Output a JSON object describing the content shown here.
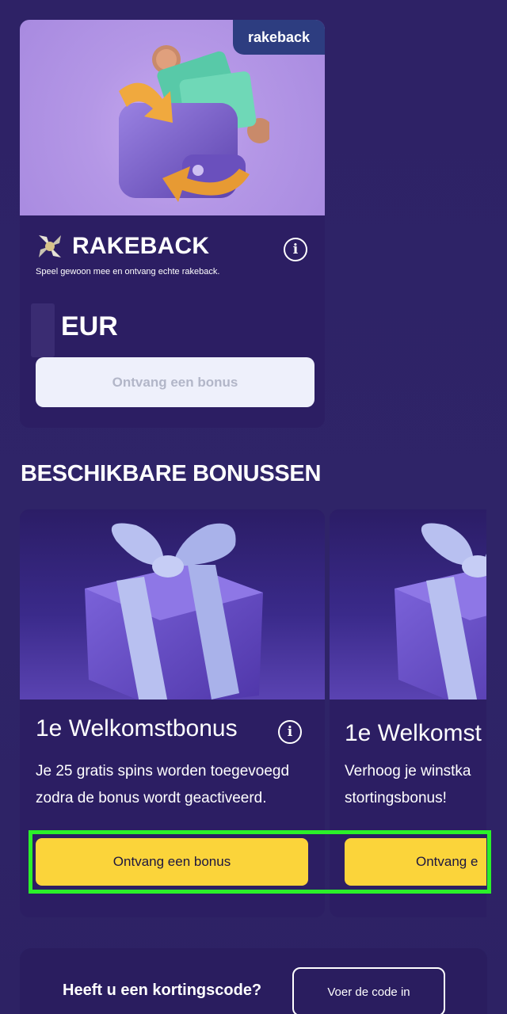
{
  "rakeback": {
    "tag": "rakeback",
    "title": "RAKEBACK",
    "description": "Speel gewoon mee en ontvang echte rakeback.",
    "currency": "EUR",
    "button_label": "Ontvang een bonus"
  },
  "available_section": {
    "title": "BESCHIKBARE BONUSSEN"
  },
  "bonuses": [
    {
      "title": "1e Welkomstbonus",
      "description": "Je 25 gratis spins worden toegevoegd zodra de bonus wordt geactiveerd.",
      "button_label": "Ontvang een bonus"
    },
    {
      "title": "1e Welkomst",
      "description": "Verhoog je winstka stortingsbonus!",
      "button_label": "Ontvang e"
    }
  ],
  "promo": {
    "label": "Heeft u een kortingscode?",
    "button_label": "Voer de code in"
  },
  "colors": {
    "background": "#2f2468",
    "card": "#2c1e63",
    "accent_yellow": "#fbd43a",
    "highlight_green": "#2bf02a"
  },
  "icons": [
    "info-icon",
    "rakeback-logo-icon",
    "wallet-illustration",
    "gift-illustration"
  ]
}
